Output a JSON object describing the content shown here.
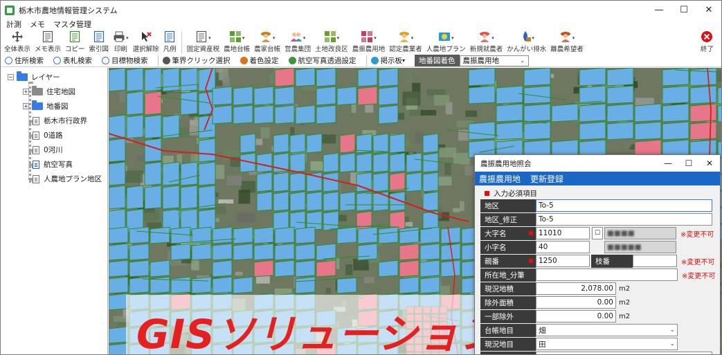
{
  "window": {
    "title": "栃木市農地情報管理システム",
    "controls": {
      "minimize": "—",
      "maximize": "☐",
      "close": "✕"
    }
  },
  "menu": [
    "計測",
    "メモ",
    "マスタ管理"
  ],
  "toolbar": [
    {
      "label": "全体表示",
      "icon": "crosshair-move-icon",
      "color": "#555555"
    },
    {
      "label": "メモ表示",
      "icon": "memo-icon",
      "color": "#555555"
    },
    {
      "label": "コピー",
      "icon": "copy-icon",
      "color": "#3a8a2a"
    },
    {
      "label": "索引図",
      "icon": "index-map-icon",
      "color": "#2a63c8"
    },
    {
      "label": "印刷",
      "icon": "printer-icon",
      "color": "#555555",
      "dropdown": true
    },
    {
      "label": "選択解除",
      "icon": "deselect-icon",
      "color": "#c03030"
    },
    {
      "label": "凡例",
      "icon": "legend-icon",
      "color": "#2a63c8"
    },
    {
      "label": "固定資産税",
      "icon": "tax-ledger-icon",
      "color": "#555555",
      "dropdown": true,
      "sep_before": true
    },
    {
      "label": "農地台帳",
      "icon": "farmland-ledger-icon",
      "color": "#5aa02a",
      "dropdown": true
    },
    {
      "label": "農家台帳",
      "icon": "farmer-ledger-icon",
      "color": "#c08020",
      "dropdown": true
    },
    {
      "label": "営農集団",
      "icon": "farming-group-icon",
      "color": "#d05080",
      "dropdown": true
    },
    {
      "label": "土地改良区",
      "icon": "land-improvement-icon",
      "color": "#6aa02a",
      "dropdown": true
    },
    {
      "label": "農振農用地",
      "icon": "agri-promotion-icon",
      "color": "#c04060",
      "dropdown": true
    },
    {
      "label": "認定農業者",
      "icon": "certified-farmer-icon",
      "color": "#e0a020",
      "dropdown": true
    },
    {
      "label": "人農地プラン",
      "icon": "plan-icon",
      "color": "#2a9ad0",
      "dropdown": true
    },
    {
      "label": "新規就農者",
      "icon": "new-farmer-icon",
      "color": "#e05050",
      "dropdown": true
    },
    {
      "label": "かんがい排水",
      "icon": "irrigation-icon",
      "color": "#2a63c8",
      "dropdown": true
    },
    {
      "label": "離農希望者",
      "icon": "retire-farmer-icon",
      "color": "#c05020",
      "dropdown": true
    },
    {
      "label": "終了",
      "icon": "exit-icon",
      "color": "#e01010",
      "far_right": true
    }
  ],
  "toolbar2": {
    "items": [
      {
        "label": "住所検索",
        "icon": "magnifier-icon"
      },
      {
        "label": "表札検索",
        "icon": "magnifier-icon"
      },
      {
        "label": "目標物検索",
        "icon": "magnifier-icon"
      },
      {
        "label": "筆界クリック選択",
        "icon": "parcel-click-icon"
      },
      {
        "label": "着色設定",
        "icon": "color-palette-icon"
      },
      {
        "label": "航空写真透過設定",
        "icon": "transparency-icon"
      },
      {
        "label": "掲示板",
        "icon": "bulletin-board-icon",
        "dropdown": true
      }
    ],
    "coloring_label": "地番図着色",
    "coloring_value": "農振農用地"
  },
  "layers": {
    "root": "レイヤー",
    "items": [
      {
        "label": "住宅地図",
        "type": "folder-gray",
        "expander": "+"
      },
      {
        "label": "地番図",
        "type": "folder-blue",
        "expander": "+"
      },
      {
        "label": "栃木市行政界",
        "type": "doc"
      },
      {
        "label": "0道路",
        "type": "doc"
      },
      {
        "label": "0河川",
        "type": "doc"
      },
      {
        "label": "航空写真",
        "type": "doc-blue"
      },
      {
        "label": "人農地プラン地区",
        "type": "doc"
      }
    ]
  },
  "banner": {
    "text": "GISソリューション"
  },
  "dialog": {
    "title": "農振農用地照会",
    "header": [
      "農振農用地",
      "更新登録"
    ],
    "section": "入力必須項目",
    "fields": [
      {
        "label": "地区",
        "value": "To-5"
      },
      {
        "label": "地区_修正",
        "value": "To-5"
      },
      {
        "label": "大字名",
        "value": "11010",
        "required": true,
        "extra": "■■■■",
        "note": "※変更不可"
      },
      {
        "label": "小字名",
        "value": "40",
        "extra": "■■■■■"
      },
      {
        "label": "親番",
        "value": "1250",
        "required": true,
        "sub_label": "枝番",
        "note": "※変更不可"
      },
      {
        "label": "所在地_分筆",
        "value": "",
        "note": "※変更不可"
      },
      {
        "label": "現況地積",
        "value": "2,078.00",
        "unit": "m2"
      },
      {
        "label": "除外面積",
        "value": "0.00",
        "unit": "m2"
      },
      {
        "label": "一部除外",
        "value": "0.00",
        "unit": "m2"
      },
      {
        "label": "台帳地目",
        "value": "畑"
      },
      {
        "label": "現況地目",
        "value": "田"
      },
      {
        "label": "現況用途",
        "value": ""
      }
    ]
  }
}
